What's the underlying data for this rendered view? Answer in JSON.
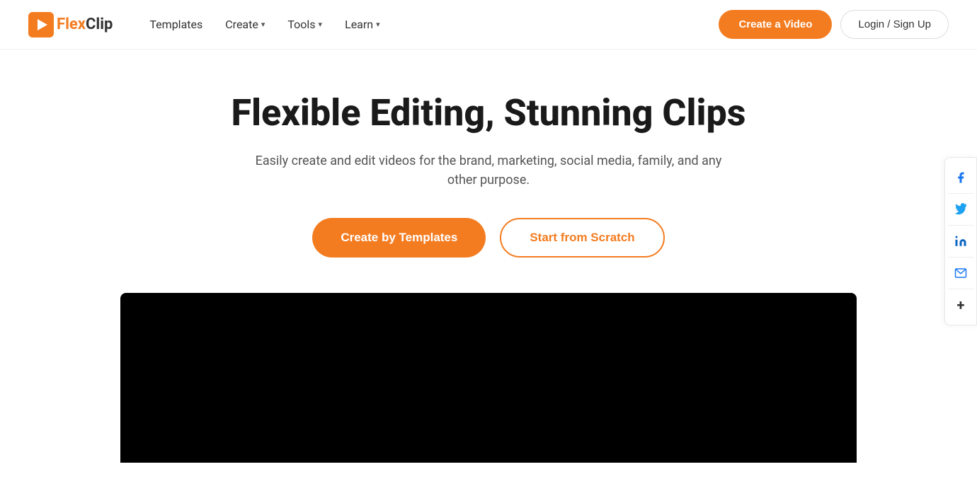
{
  "brand": {
    "name_flex": "Flex",
    "name_clip": "Clip"
  },
  "navbar": {
    "templates_label": "Templates",
    "create_label": "Create",
    "tools_label": "Tools",
    "learn_label": "Learn",
    "create_video_label": "Create a Video",
    "login_label": "Login / Sign Up"
  },
  "hero": {
    "title": "Flexible Editing, Stunning Clips",
    "subtitle": "Easily create and edit videos for the brand, marketing, social media, family, and any other purpose.",
    "btn_templates": "Create by Templates",
    "btn_scratch": "Start from Scratch"
  },
  "social": {
    "facebook_label": "f",
    "twitter_label": "t",
    "linkedin_label": "in",
    "email_label": "✉",
    "more_label": "+"
  },
  "colors": {
    "accent": "#f47c20",
    "facebook": "#1877f2",
    "twitter": "#1da1f2",
    "linkedin": "#0a66c2"
  }
}
